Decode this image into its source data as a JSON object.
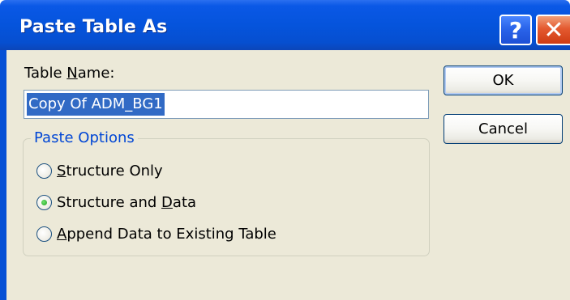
{
  "window": {
    "title": "Paste Table As",
    "help_button": "?",
    "close_button": "✕"
  },
  "table_name": {
    "label_pre": "Table ",
    "label_mnemonic": "N",
    "label_post": "ame:",
    "value": "Copy Of ADM_BG1"
  },
  "paste_options": {
    "legend": "Paste Options",
    "options": [
      {
        "mnemonic": "S",
        "rest": "tructure Only",
        "pre": "",
        "checked": false
      },
      {
        "pre": "Structure and ",
        "mnemonic": "D",
        "rest": "ata",
        "checked": true
      },
      {
        "pre": "",
        "mnemonic": "A",
        "rest": "ppend Data to Existing Table",
        "checked": false
      }
    ]
  },
  "buttons": {
    "ok": "OK",
    "cancel": "Cancel"
  },
  "colors": {
    "titlebar": "#0554dc",
    "dialog_bg": "#ece9d8",
    "selection": "#316ac5",
    "legend_text": "#0046d5"
  }
}
